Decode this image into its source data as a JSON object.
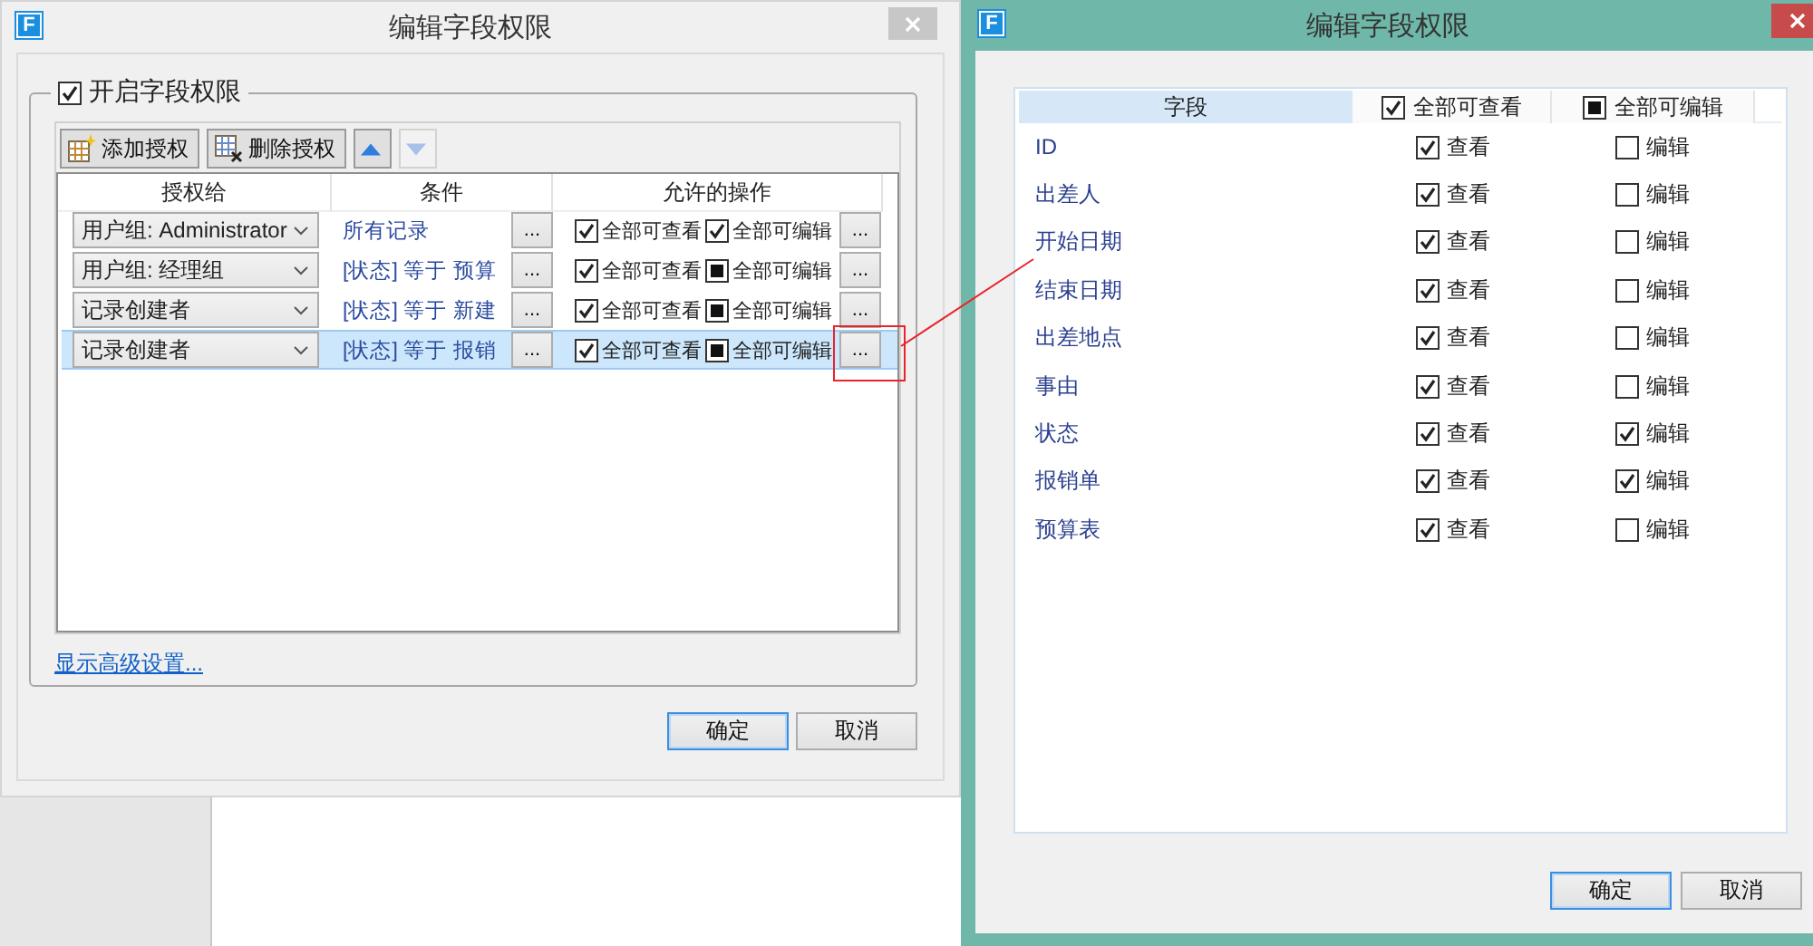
{
  "left_dialog": {
    "app_icon": "F",
    "title": "编辑字段权限",
    "enable_checkbox": {
      "label": "开启字段权限",
      "checked": true
    },
    "toolbar": [
      {
        "kind": "add",
        "label": "添加授权",
        "disabled": false
      },
      {
        "kind": "delete",
        "label": "删除授权",
        "disabled": false
      },
      {
        "kind": "up",
        "disabled": false
      },
      {
        "kind": "down",
        "disabled": true
      }
    ],
    "columns": [
      "授权给",
      "条件",
      "允许的操作"
    ],
    "rows": [
      {
        "grantee": "用户组: Administrator",
        "condition": "所有记录",
        "condition_button": "...",
        "view_all": {
          "label": "全部可查看",
          "checked": true,
          "partial": false
        },
        "edit_all": {
          "label": "全部可编辑",
          "checked": true,
          "partial": false
        },
        "ops_button": "...",
        "selected": false,
        "highlighted": false
      },
      {
        "grantee": "用户组: 经理组",
        "condition": "[状态] 等于 预算",
        "condition_button": "...",
        "view_all": {
          "label": "全部可查看",
          "checked": true,
          "partial": false
        },
        "edit_all": {
          "label": "全部可编辑",
          "checked": false,
          "partial": true
        },
        "ops_button": "...",
        "selected": false,
        "highlighted": false
      },
      {
        "grantee": "记录创建者",
        "condition": "[状态] 等于 新建",
        "condition_button": "...",
        "view_all": {
          "label": "全部可查看",
          "checked": true,
          "partial": false
        },
        "edit_all": {
          "label": "全部可编辑",
          "checked": false,
          "partial": true
        },
        "ops_button": "...",
        "selected": false,
        "highlighted": false
      },
      {
        "grantee": "记录创建者",
        "condition": "[状态] 等于 报销",
        "condition_button": "...",
        "view_all": {
          "label": "全部可查看",
          "checked": true,
          "partial": false
        },
        "edit_all": {
          "label": "全部可编辑",
          "checked": false,
          "partial": true
        },
        "ops_button": "...",
        "selected": true,
        "highlighted": true
      }
    ],
    "link": "显示高级设置...",
    "buttons": [
      {
        "label": "确定",
        "focused": true
      },
      {
        "label": "取消",
        "focused": false
      }
    ]
  },
  "right_dialog": {
    "app_icon": "F",
    "title": "编辑字段权限",
    "columns": [
      {
        "label": "字段",
        "kind": "text"
      },
      {
        "label": "全部可查看",
        "kind": "checkbox",
        "checked": true,
        "partial": false
      },
      {
        "label": "全部可编辑",
        "kind": "checkbox",
        "checked": false,
        "partial": true
      }
    ],
    "rows": [
      {
        "field": "ID",
        "view": {
          "label": "查看",
          "checked": true
        },
        "edit": {
          "label": "编辑",
          "checked": false
        }
      },
      {
        "field": "出差人",
        "view": {
          "label": "查看",
          "checked": true
        },
        "edit": {
          "label": "编辑",
          "checked": false
        }
      },
      {
        "field": "开始日期",
        "view": {
          "label": "查看",
          "checked": true
        },
        "edit": {
          "label": "编辑",
          "checked": false
        }
      },
      {
        "field": "结束日期",
        "view": {
          "label": "查看",
          "checked": true
        },
        "edit": {
          "label": "编辑",
          "checked": false
        }
      },
      {
        "field": "出差地点",
        "view": {
          "label": "查看",
          "checked": true
        },
        "edit": {
          "label": "编辑",
          "checked": false
        }
      },
      {
        "field": "事由",
        "view": {
          "label": "查看",
          "checked": true
        },
        "edit": {
          "label": "编辑",
          "checked": false
        }
      },
      {
        "field": "状态",
        "view": {
          "label": "查看",
          "checked": true
        },
        "edit": {
          "label": "编辑",
          "checked": true
        }
      },
      {
        "field": "报销单",
        "view": {
          "label": "查看",
          "checked": true
        },
        "edit": {
          "label": "编辑",
          "checked": true
        }
      },
      {
        "field": "预算表",
        "view": {
          "label": "查看",
          "checked": true
        },
        "edit": {
          "label": "编辑",
          "checked": false
        }
      }
    ],
    "buttons": [
      {
        "label": "确定",
        "focused": true
      },
      {
        "label": "取消",
        "focused": false
      }
    ]
  }
}
